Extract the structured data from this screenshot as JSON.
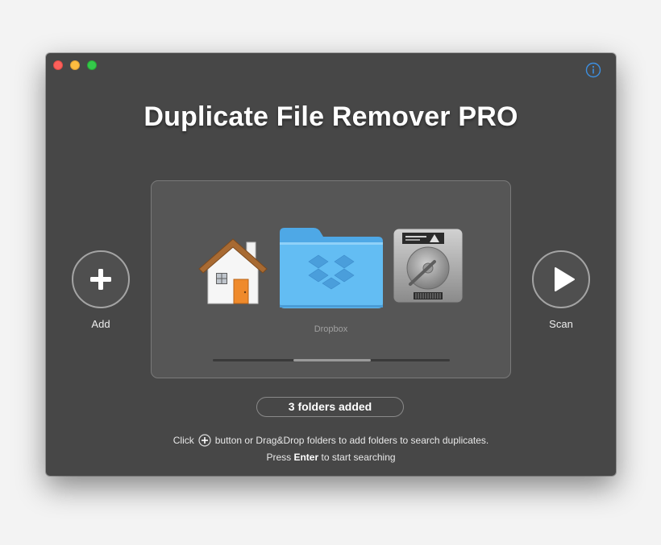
{
  "app": {
    "title": "Duplicate File Remover PRO"
  },
  "toolbar": {
    "add_label": "Add",
    "scan_label": "Scan"
  },
  "drop_area": {
    "folders": [
      {
        "icon": "home-folder-icon",
        "label": ""
      },
      {
        "icon": "dropbox-folder-icon",
        "label": "Dropbox"
      },
      {
        "icon": "hard-drive-icon",
        "label": ""
      }
    ],
    "selected_caption": "Dropbox"
  },
  "status": {
    "folders_added": "3 folders added"
  },
  "hints": {
    "line1_before": "Click",
    "line1_after": "button or Drag&Drop folders to add folders to search duplicates.",
    "line2_before": "Press",
    "line2_key": "Enter",
    "line2_after": "to start searching"
  },
  "colors": {
    "window_bg": "#474747",
    "panel_bg": "#565656",
    "folder_blue": "#5db6ee",
    "info_blue": "#3d8fe0",
    "close": "#fc605b",
    "minimize": "#fdbc40",
    "maximize": "#34c84a"
  }
}
